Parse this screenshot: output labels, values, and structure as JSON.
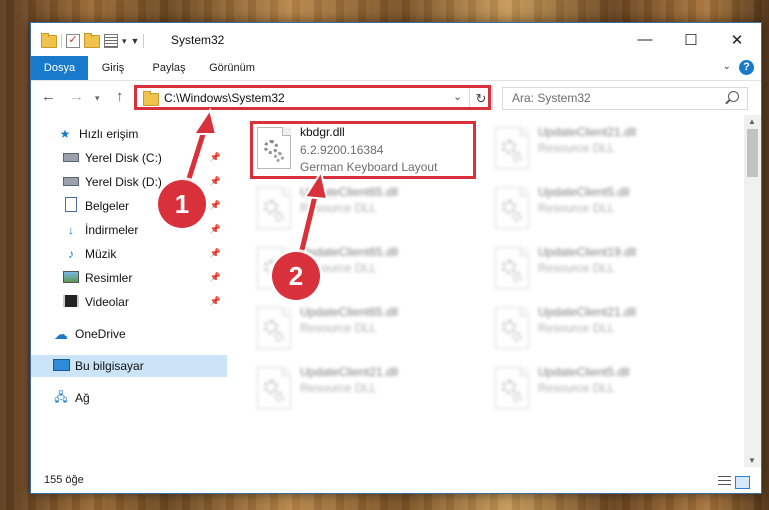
{
  "window": {
    "title": "System32",
    "controls": {
      "minimize": "—",
      "maximize": "☐",
      "close": "✕"
    }
  },
  "ribbon": {
    "tabs": [
      "Dosya",
      "Giriş",
      "Paylaş",
      "Görünüm"
    ],
    "help": "?"
  },
  "address": {
    "path": "C:\\Windows\\System32",
    "search_placeholder": "Ara: System32"
  },
  "sidebar": {
    "quick_access": "Hızlı erişim",
    "items": [
      {
        "label": "Yerel Disk (C:)",
        "icon": "drive-icon"
      },
      {
        "label": "Yerel Disk (D:)",
        "icon": "drive-icon"
      },
      {
        "label": "Belgeler",
        "icon": "documents-icon"
      },
      {
        "label": "İndirmeler",
        "icon": "download-icon"
      },
      {
        "label": "Müzik",
        "icon": "music-icon"
      },
      {
        "label": "Resimler",
        "icon": "pictures-icon"
      },
      {
        "label": "Videolar",
        "icon": "videos-icon"
      }
    ],
    "onedrive": "OneDrive",
    "this_pc": "Bu bilgisayar",
    "network": "Ağ"
  },
  "files": {
    "highlight": {
      "name": "kbdgr.dll",
      "version": "6.2.9200.16384",
      "description": "German Keyboard Layout"
    },
    "others": [
      {
        "name": "UpdateClient21.dll",
        "type": "Resource DLL"
      },
      {
        "name": "UpdateClient65.dll",
        "type": "Resource DLL"
      },
      {
        "name": "UpdateClient5.dll",
        "type": "Resource DLL"
      },
      {
        "name": "UpdateClient65.dll",
        "type": "Resource DLL"
      },
      {
        "name": "UpdateClient19.dll",
        "type": "Resource DLL"
      },
      {
        "name": "UpdateClient65.dll",
        "type": "Resource DLL"
      },
      {
        "name": "UpdateClient21.dll",
        "type": "Resource DLL"
      },
      {
        "name": "UpdateClient21.dll",
        "type": "Resource DLL"
      },
      {
        "name": "UpdateClient5.dll",
        "type": "Resource DLL"
      }
    ]
  },
  "status": {
    "count": "155 öğe"
  },
  "annotations": {
    "step1": "1",
    "step2": "2",
    "color": "#d8313b"
  }
}
